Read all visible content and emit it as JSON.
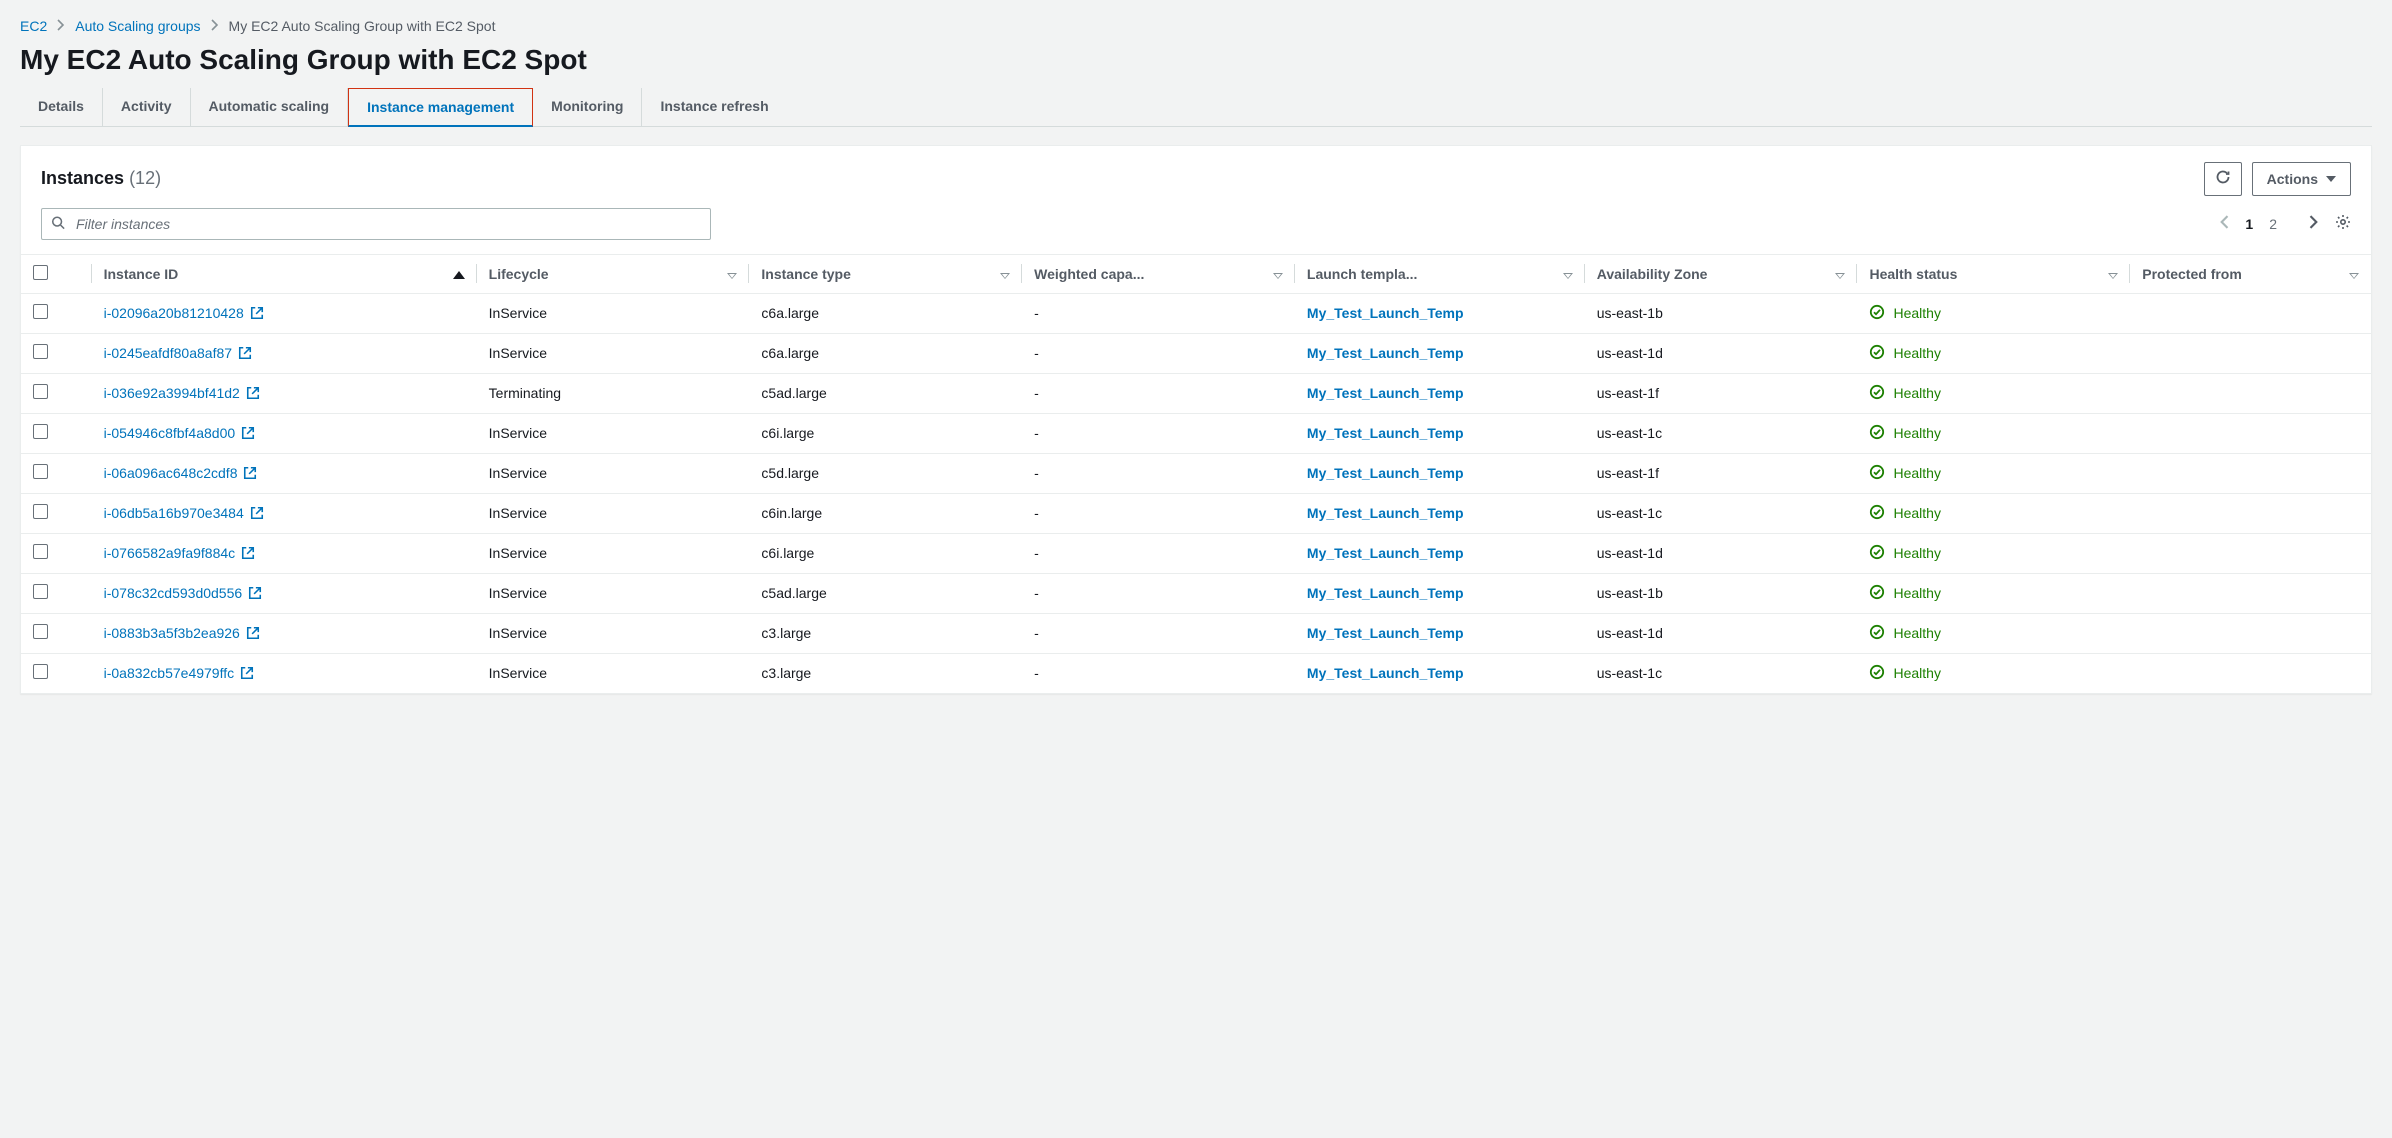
{
  "breadcrumbs": {
    "items": [
      {
        "label": "EC2",
        "link": true
      },
      {
        "label": "Auto Scaling groups",
        "link": true
      },
      {
        "label": "My EC2 Auto Scaling Group with EC2 Spot",
        "link": false
      }
    ]
  },
  "page_title": "My EC2 Auto Scaling Group with EC2 Spot",
  "tabs": [
    {
      "id": "details",
      "label": "Details",
      "active": false
    },
    {
      "id": "activity",
      "label": "Activity",
      "active": false
    },
    {
      "id": "auto-scaling",
      "label": "Automatic scaling",
      "active": false
    },
    {
      "id": "instance-mgmt",
      "label": "Instance management",
      "active": true
    },
    {
      "id": "monitoring",
      "label": "Monitoring",
      "active": false
    },
    {
      "id": "instance-refresh",
      "label": "Instance refresh",
      "active": false
    }
  ],
  "panel": {
    "title": "Instances",
    "count_display": "(12)",
    "actions_button_label": "Actions",
    "filter_placeholder": "Filter instances",
    "pagination": {
      "pages": [
        "1",
        "2"
      ],
      "current": "1"
    },
    "columns": [
      {
        "key": "instance_id",
        "label": "Instance ID",
        "sorted": "asc"
      },
      {
        "key": "lifecycle",
        "label": "Lifecycle"
      },
      {
        "key": "instance_type",
        "label": "Instance type"
      },
      {
        "key": "weighted",
        "label": "Weighted capa..."
      },
      {
        "key": "launch_template",
        "label": "Launch templa..."
      },
      {
        "key": "az",
        "label": "Availability Zone"
      },
      {
        "key": "health",
        "label": "Health status"
      },
      {
        "key": "protected",
        "label": "Protected from"
      }
    ],
    "rows": [
      {
        "instance_id": "i-02096a20b81210428",
        "lifecycle": "InService",
        "instance_type": "c6a.large",
        "weighted": "-",
        "launch_template": "My_Test_Launch_Temp",
        "az": "us-east-1b",
        "health": "Healthy",
        "protected": ""
      },
      {
        "instance_id": "i-0245eafdf80a8af87",
        "lifecycle": "InService",
        "instance_type": "c6a.large",
        "weighted": "-",
        "launch_template": "My_Test_Launch_Temp",
        "az": "us-east-1d",
        "health": "Healthy",
        "protected": ""
      },
      {
        "instance_id": "i-036e92a3994bf41d2",
        "lifecycle": "Terminating",
        "instance_type": "c5ad.large",
        "weighted": "-",
        "launch_template": "My_Test_Launch_Temp",
        "az": "us-east-1f",
        "health": "Healthy",
        "protected": ""
      },
      {
        "instance_id": "i-054946c8fbf4a8d00",
        "lifecycle": "InService",
        "instance_type": "c6i.large",
        "weighted": "-",
        "launch_template": "My_Test_Launch_Temp",
        "az": "us-east-1c",
        "health": "Healthy",
        "protected": ""
      },
      {
        "instance_id": "i-06a096ac648c2cdf8",
        "lifecycle": "InService",
        "instance_type": "c5d.large",
        "weighted": "-",
        "launch_template": "My_Test_Launch_Temp",
        "az": "us-east-1f",
        "health": "Healthy",
        "protected": ""
      },
      {
        "instance_id": "i-06db5a16b970e3484",
        "lifecycle": "InService",
        "instance_type": "c6in.large",
        "weighted": "-",
        "launch_template": "My_Test_Launch_Temp",
        "az": "us-east-1c",
        "health": "Healthy",
        "protected": ""
      },
      {
        "instance_id": "i-0766582a9fa9f884c",
        "lifecycle": "InService",
        "instance_type": "c6i.large",
        "weighted": "-",
        "launch_template": "My_Test_Launch_Temp",
        "az": "us-east-1d",
        "health": "Healthy",
        "protected": ""
      },
      {
        "instance_id": "i-078c32cd593d0d556",
        "lifecycle": "InService",
        "instance_type": "c5ad.large",
        "weighted": "-",
        "launch_template": "My_Test_Launch_Temp",
        "az": "us-east-1b",
        "health": "Healthy",
        "protected": ""
      },
      {
        "instance_id": "i-0883b3a5f3b2ea926",
        "lifecycle": "InService",
        "instance_type": "c3.large",
        "weighted": "-",
        "launch_template": "My_Test_Launch_Temp",
        "az": "us-east-1d",
        "health": "Healthy",
        "protected": ""
      },
      {
        "instance_id": "i-0a832cb57e4979ffc",
        "lifecycle": "InService",
        "instance_type": "c3.large",
        "weighted": "-",
        "launch_template": "My_Test_Launch_Temp",
        "az": "us-east-1c",
        "health": "Healthy",
        "protected": ""
      }
    ]
  }
}
